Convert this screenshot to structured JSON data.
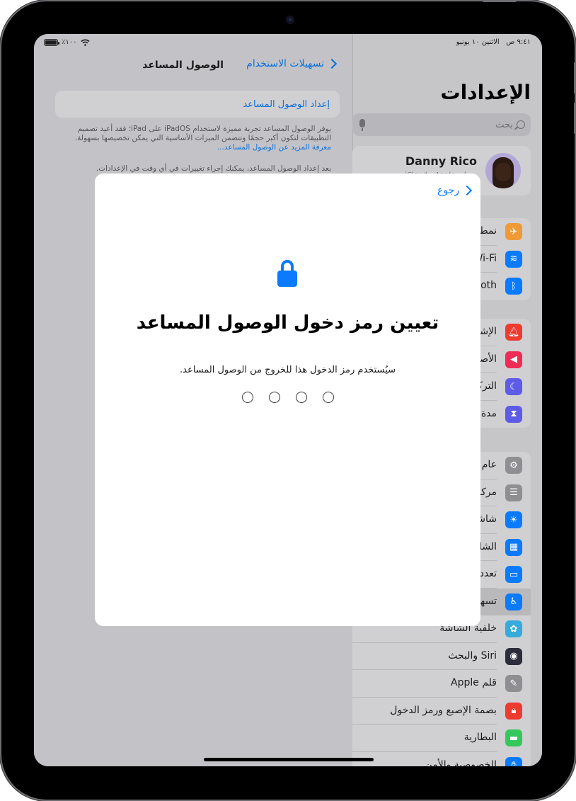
{
  "status_bar": {
    "time": "٩:٤١ ص",
    "date": "الاثنين ١٠ يونيو",
    "battery_percent": "٪١٠٠",
    "battery_level": 1.0
  },
  "detail": {
    "back_label": "تسهيلات الاستخدام",
    "title": "الوصول المساعد",
    "setup_button": "إعداد الوصول المساعد",
    "footnote": "يوفر الوصول المساعد تجربة مميزة لاستخدام iPadOS على iPad؛ فقد أعيد تصميم التطبيقات لتكون أكبر حجمًا وتتضمن الميزات الأساسية التي يمكن تخصيصها بسهولة.",
    "learn_more_link": "معرفة المزيد عن الوصول المساعد...",
    "footnote2": "بعد إعداد الوصول المساعد، يمكنك إجراء تغييرات في أي وقت في الإعدادات."
  },
  "sidebar": {
    "title": "الإعدادات",
    "search_placeholder": "بحث",
    "profile": {
      "name": "Danny Rico",
      "subtitle": "حساب Apple و iCloud و..."
    },
    "groups": [
      {
        "items": [
          {
            "label": "نمط الطيران",
            "icon": "airplane-icon",
            "color": "#f09a37"
          },
          {
            "label": "Wi-Fi",
            "icon": "wifi-icon",
            "color": "#0a7aff"
          },
          {
            "label": "Bluetooth",
            "icon": "bluetooth-icon",
            "color": "#0a7aff"
          }
        ]
      },
      {
        "items": [
          {
            "label": "الإشعارات",
            "icon": "bell-icon",
            "color": "#ee3b30"
          },
          {
            "label": "الأصوات",
            "icon": "speaker-icon",
            "color": "#ee2d55"
          },
          {
            "label": "التركيز",
            "icon": "moon-icon",
            "color": "#5e5ce6"
          },
          {
            "label": "مدة استخدام الجهاز",
            "icon": "hourglass-icon",
            "color": "#5e5ce6"
          }
        ]
      },
      {
        "items": [
          {
            "label": "عام",
            "icon": "gear-icon",
            "color": "#8e8e93"
          },
          {
            "label": "مركز التحكم",
            "icon": "toggles-icon",
            "color": "#8e8e93"
          },
          {
            "label": "شاشة العرض والإضاءة",
            "icon": "sun-icon",
            "color": "#0a7aff"
          },
          {
            "label": "الشاشة الرئيسية",
            "icon": "home-screen-icon",
            "color": "#0a7aff"
          },
          {
            "label": "تعدد المهام",
            "icon": "multitask-icon",
            "color": "#0a7aff"
          },
          {
            "label": "تسهيلات الاستخدام",
            "icon": "accessibility-icon",
            "color": "#0a7aff",
            "selected": true
          },
          {
            "label": "خلفية الشاشة",
            "icon": "flower-icon",
            "color": "#36aadc"
          },
          {
            "label": "Siri والبحث",
            "icon": "siri-icon",
            "color": "#2c2c3a"
          },
          {
            "label": "قلم Apple",
            "icon": "pencil-icon",
            "color": "#8e8e93"
          },
          {
            "label": "بصمة الإصبع ورمز الدخول",
            "icon": "lock-icon",
            "color": "#ee3b30"
          },
          {
            "label": "البطارية",
            "icon": "battery-icon",
            "color": "#34c759"
          },
          {
            "label": "الخصوصية والأمن",
            "icon": "hand-icon",
            "color": "#0a7aff"
          }
        ]
      }
    ]
  },
  "modal": {
    "back_label": "رجوع",
    "heading": "تعيين رمز دخول الوصول المساعد",
    "description": "سيُستخدم رمز الدخول هذا للخروج من الوصول المساعد.",
    "passcode_length": 4,
    "passcode_entered": 0
  },
  "colors": {
    "accent": "#0a7aff"
  }
}
